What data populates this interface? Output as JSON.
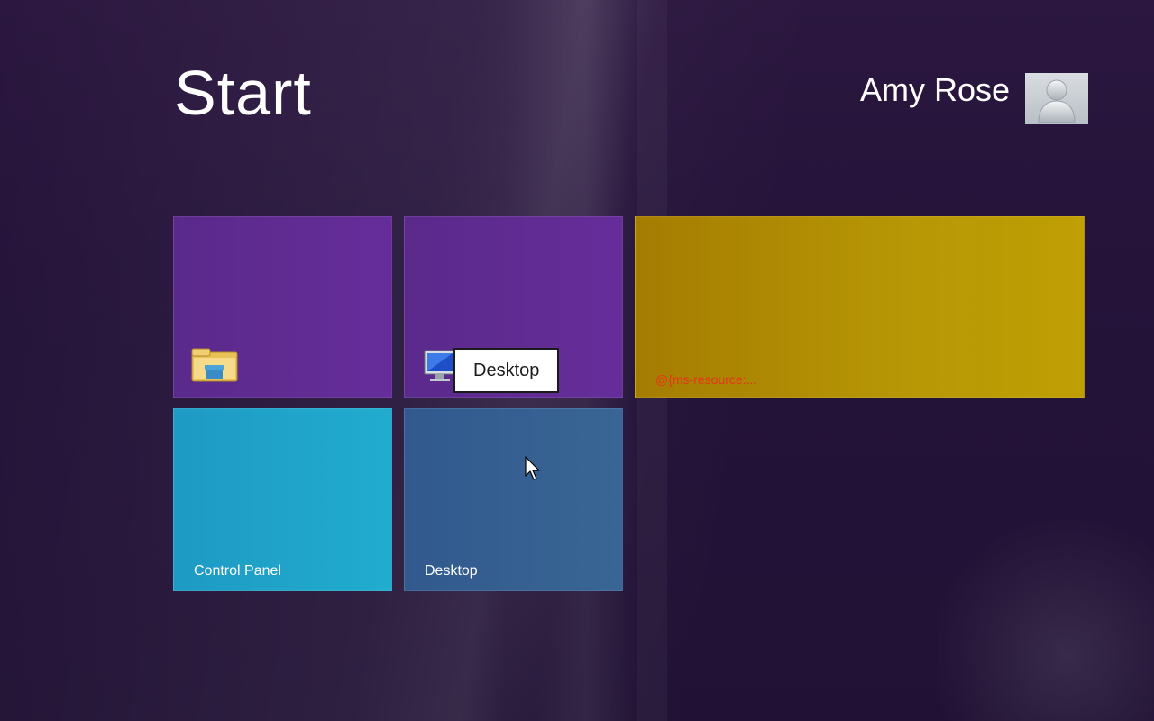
{
  "screen": {
    "title": "Start"
  },
  "user": {
    "name": "Amy Rose",
    "avatar_icon": "user-silhouette-icon"
  },
  "tiles": [
    {
      "id": "file-explorer",
      "label": "",
      "color": "#5f2c93",
      "icon": "folder-icon"
    },
    {
      "id": "computer",
      "label": "",
      "color": "#5f2c93",
      "icon": "computer-icon"
    },
    {
      "id": "wide",
      "label": "@{ms-resource:...",
      "color": "#b38f04",
      "icon": ""
    },
    {
      "id": "control-panel",
      "label": "Control Panel",
      "color": "#20a4c9",
      "icon": ""
    },
    {
      "id": "desktop",
      "label": "Desktop",
      "color": "#355f91",
      "icon": ""
    }
  ],
  "tooltip": {
    "text": "Desktop"
  },
  "colors": {
    "background": "#231238",
    "accent_purple": "#5f2c93",
    "accent_gold": "#b38f04",
    "accent_cyan": "#20a4c9",
    "accent_blue": "#355f91",
    "resource_text": "#e8341c"
  }
}
